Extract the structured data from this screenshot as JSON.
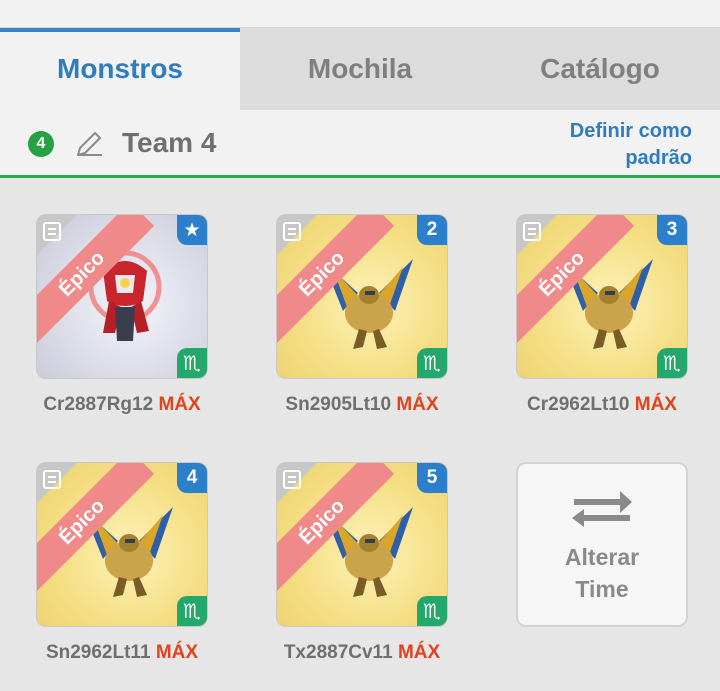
{
  "tabs": [
    {
      "label": "Monstros",
      "active": true
    },
    {
      "label": "Mochila",
      "active": false
    },
    {
      "label": "Catálogo",
      "active": false
    }
  ],
  "team": {
    "number": "4",
    "name": "Team 4",
    "set_default_label": "Definir como padrão"
  },
  "monsters": [
    {
      "rarity": "Épico",
      "slot": "★",
      "element_icon": "♏",
      "name": "Cr2887Rg12",
      "level": "MÁX",
      "style": "silver"
    },
    {
      "rarity": "Épico",
      "slot": "2",
      "element_icon": "♏",
      "name": "Sn2905Lt10",
      "level": "MÁX",
      "style": "gold"
    },
    {
      "rarity": "Épico",
      "slot": "3",
      "element_icon": "♏",
      "name": "Cr2962Lt10",
      "level": "MÁX",
      "style": "gold"
    },
    {
      "rarity": "Épico",
      "slot": "4",
      "element_icon": "♏",
      "name": "Sn2962Lt11",
      "level": "MÁX",
      "style": "gold"
    },
    {
      "rarity": "Épico",
      "slot": "5",
      "element_icon": "♏",
      "name": "Tx2887Cv11",
      "level": "MÁX",
      "style": "gold"
    }
  ],
  "swap_button": {
    "label": "Alterar Time"
  },
  "colors": {
    "accent_blue": "#2f7dbf",
    "green": "#27a143",
    "max_red": "#e2431c",
    "ribbon": "#f08a8a"
  }
}
